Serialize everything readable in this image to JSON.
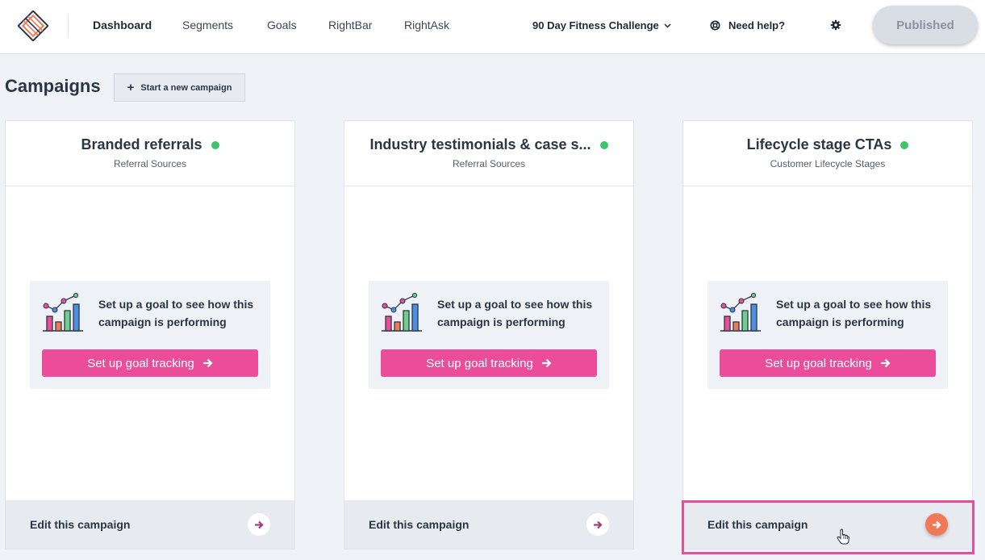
{
  "nav": {
    "links": [
      {
        "label": "Dashboard",
        "active": true
      },
      {
        "label": "Segments",
        "active": false
      },
      {
        "label": "Goals",
        "active": false
      },
      {
        "label": "RightBar",
        "active": false
      },
      {
        "label": "RightAsk",
        "active": false
      }
    ],
    "project": "90 Day Fitness Challenge",
    "help": "Need help?",
    "published": "Published"
  },
  "page": {
    "title": "Campaigns",
    "new_campaign": "Start a new campaign"
  },
  "cards": [
    {
      "title": "Branded referrals",
      "subtitle": "Referral Sources",
      "status": "active",
      "goal_text": "Set up a goal to see how this campaign is performing",
      "goal_button": "Set up goal tracking",
      "edit": "Edit this campaign"
    },
    {
      "title": "Industry testimonials & case s...",
      "subtitle": "Referral Sources",
      "status": "active",
      "goal_text": "Set up a goal to see how this campaign is performing",
      "goal_button": "Set up goal tracking",
      "edit": "Edit this campaign"
    },
    {
      "title": "Lifecycle stage CTAs",
      "subtitle": "Customer Lifecycle Stages",
      "status": "active",
      "goal_text": "Set up a goal to see how this campaign is performing",
      "goal_button": "Set up goal tracking",
      "edit": "Edit this campaign",
      "hovered": true
    }
  ],
  "colors": {
    "accent_pink": "#ec4d9b",
    "status_green": "#3ec46d",
    "hover_orange": "#f07a57"
  }
}
